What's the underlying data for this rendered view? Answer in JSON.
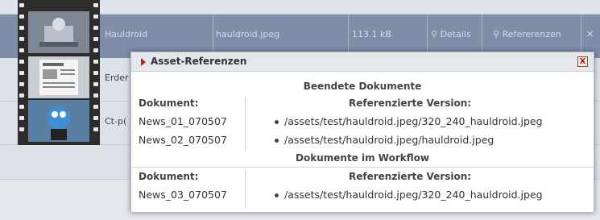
{
  "background": {
    "rows": [
      {
        "name": "Hauldroid",
        "file": "hauldroid.jpeg",
        "size": "113.1 kB",
        "details": "Details",
        "references": "Refererenzen"
      },
      {
        "name": "Erder",
        "file": "",
        "size": "",
        "details": "",
        "references": ""
      },
      {
        "name": "Ct-p(",
        "file": "",
        "size": "",
        "details": "",
        "references": ""
      }
    ]
  },
  "popup": {
    "title": "Asset-Referenzen",
    "close": "X",
    "sections": [
      {
        "heading": "Beendete Dokumente",
        "doc_label": "Dokument:",
        "ref_label": "Referenzierte Version:",
        "rows": [
          {
            "doc": "News_01_070507",
            "ref": "/assets/test/hauldroid.jpeg/320_240_hauldroid.jpeg"
          },
          {
            "doc": "News_02_070507",
            "ref": "/assets/test/hauldroid.jpeg/hauldroid.jpeg"
          }
        ]
      },
      {
        "heading": "Dokumente im Workflow",
        "doc_label": "Dokument:",
        "ref_label": "Referenzierte Version:",
        "rows": [
          {
            "doc": "News_03_070507",
            "ref": "/assets/test/hauldroid.jpeg/320_240_hauldroid.jpeg"
          }
        ]
      }
    ]
  },
  "colors": {
    "accent": "#b02810",
    "selected_row": "#7e8ea8"
  }
}
